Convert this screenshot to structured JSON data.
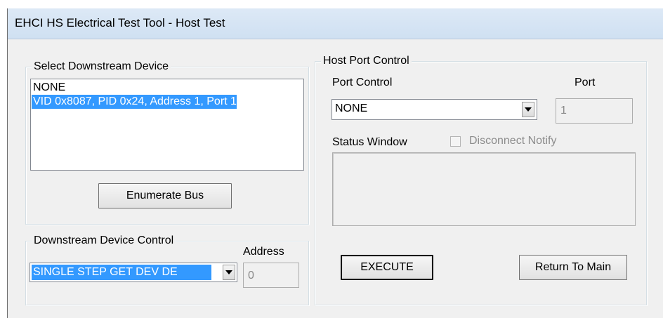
{
  "window": {
    "title": "EHCI HS Electrical Test Tool - Host Test"
  },
  "select_device": {
    "legend": "Select Downstream Device",
    "items": [
      {
        "label": "NONE",
        "selected": false
      },
      {
        "label": "VID 0x8087, PID 0x24, Address 1, Port 1",
        "selected": true
      }
    ],
    "enumerate_label": "Enumerate Bus"
  },
  "device_control": {
    "legend": "Downstream Device Control",
    "command_value": "SINGLE STEP GET DEV DE",
    "address_label": "Address",
    "address_value": "0"
  },
  "host_port": {
    "legend": "Host Port Control",
    "port_control_label": "Port Control",
    "port_control_value": "NONE",
    "port_label": "Port",
    "port_value": "1",
    "status_label": "Status Window",
    "disconnect_label": "Disconnect Notify",
    "disconnect_checked": false,
    "execute_label": "EXECUTE",
    "return_label": "Return To Main"
  },
  "colors": {
    "selection": "#3399ff",
    "titlebar": "#cfe0f2",
    "dialog": "#f0f0f0"
  }
}
